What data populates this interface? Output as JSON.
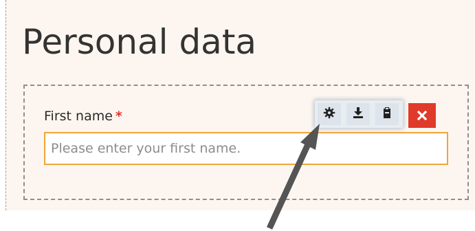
{
  "section": {
    "title": "Personal data"
  },
  "field": {
    "label": "First name",
    "required_marker": "*",
    "placeholder": "Please enter your first name.",
    "value": ""
  },
  "toolbar": {
    "settings_glyph": "⚙",
    "download_glyph": "⭳",
    "paste_glyph": "📋",
    "close_glyph": "✖"
  },
  "colors": {
    "panel_bg": "#fdf6f0",
    "input_border": "#f0a43a",
    "required": "#e4352a",
    "close_bg": "#e03a2a"
  }
}
